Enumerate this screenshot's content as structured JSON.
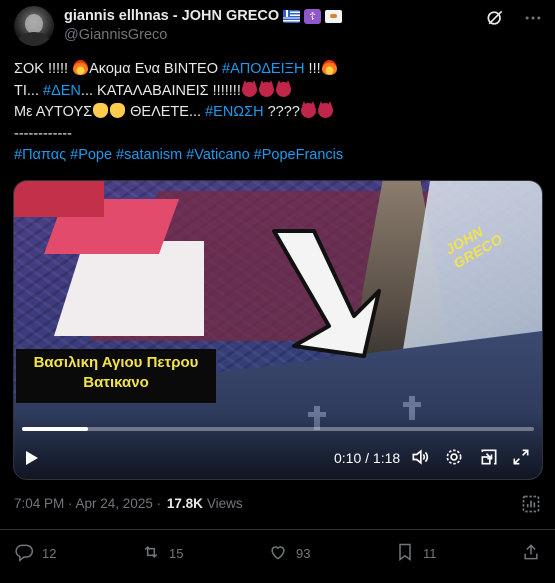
{
  "author": {
    "display_name": "giannis ellhnas - JOHN GRECO",
    "handle": "@GiannisGreco"
  },
  "tweet": {
    "lines": [
      {
        "text": "ΣΟΚ !!!!!",
        "hash": "#ΑΠΟΔΕΙΞΗ",
        "mid": "Ακομα Ενα ΒΙΝΤΕΟ",
        "tail": "!!!"
      },
      {
        "pre": "ΤΙ...",
        "hash": "#ΔΕΝ",
        "tail": "... ΚΑΤΑΛΑΒΑΙΝΕΙΣ !!!!!!!"
      },
      {
        "pre": "Με ΑΥΤΟΥΣ",
        "mid": "ΘΕΛΕΤΕ...",
        "hash": "#ΕΝΩΣΗ",
        "tail": "????"
      }
    ],
    "separator": "------------",
    "hashtags": [
      "#Παπας",
      "#Pope",
      "#satanism",
      "#Vaticano",
      "#PopeFrancis"
    ]
  },
  "video": {
    "caption_line1": "Βασιλικη Αγιου Πετρου",
    "caption_line2": "Βατικανο",
    "watermark": "JOHN GRECO",
    "time": "0:10 / 1:18",
    "progress": 0.128
  },
  "meta": {
    "time": "7:04 PM · Apr 24, 2025 ·",
    "views_count": "17.8K",
    "views_label": "Views"
  },
  "actions": {
    "replies": "12",
    "reposts": "15",
    "likes": "93",
    "bookmarks": "11"
  },
  "icons": {
    "grok": "grok-icon",
    "more": "more-icon",
    "reply": "reply-icon",
    "repost": "repost-icon",
    "like": "heart-icon",
    "bookmark": "bookmark-icon",
    "share": "share-icon",
    "analytics": "analytics-icon",
    "volume": "volume-icon",
    "settings": "settings-icon",
    "pip": "picture-in-picture-icon",
    "fullscreen": "fullscreen-icon"
  },
  "colors": {
    "background": "#000000",
    "text": "#e7e9ea",
    "secondary": "#71767b",
    "link": "#1d9bf0",
    "caption_text": "#f3e34a"
  }
}
